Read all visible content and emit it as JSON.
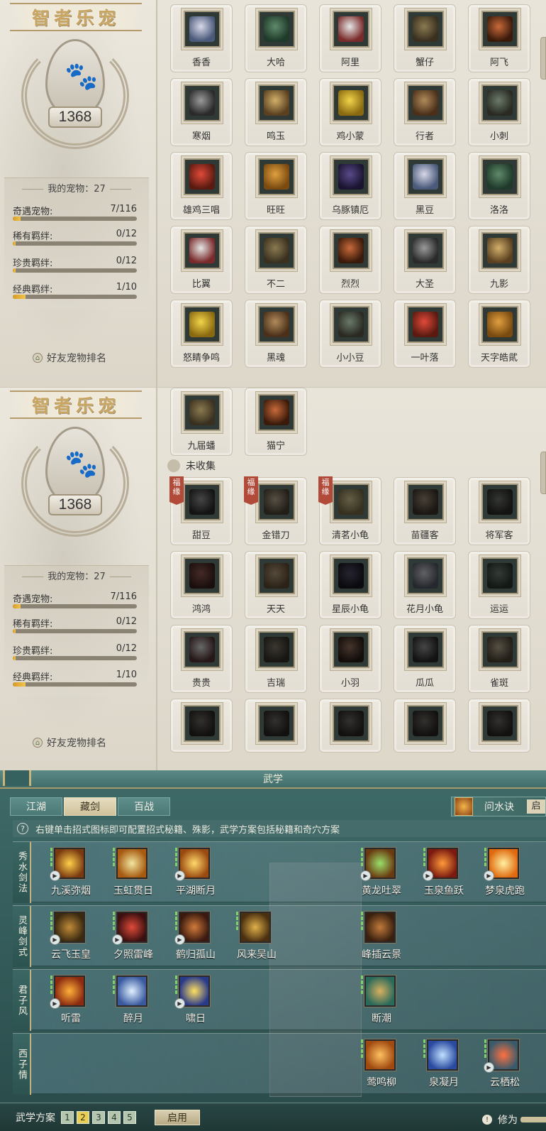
{
  "panel1": {
    "title": "智者乐宠",
    "score": "1368",
    "my_pets_label": "我的宠物：27",
    "stats": [
      {
        "name": "奇遇宠物:",
        "value": "7/116",
        "fraction": 0.06
      },
      {
        "name": "稀有羁绊:",
        "value": "0/12",
        "fraction": 0.0
      },
      {
        "name": "珍贵羁绊:",
        "value": "0/12",
        "fraction": 0.0
      },
      {
        "name": "经典羁绊:",
        "value": "1/10",
        "fraction": 0.1
      }
    ],
    "friend_rank": "好友宠物排名",
    "pets": [
      {
        "name": "香香"
      },
      {
        "name": "大哈"
      },
      {
        "name": "阿里"
      },
      {
        "name": "蟹仔"
      },
      {
        "name": "阿飞"
      },
      {
        "name": "寒烟"
      },
      {
        "name": "鸣玉"
      },
      {
        "name": "鸡小蒙"
      },
      {
        "name": "行者"
      },
      {
        "name": "小刺"
      },
      {
        "name": "雄鸡三唱"
      },
      {
        "name": "旺旺"
      },
      {
        "name": "乌豚镇厄"
      },
      {
        "name": "黑豆"
      },
      {
        "name": "洛洛"
      },
      {
        "name": "比翼"
      },
      {
        "name": "不二"
      },
      {
        "name": "烈烈"
      },
      {
        "name": "大圣"
      },
      {
        "name": "九影"
      },
      {
        "name": "怒睛争鸣"
      },
      {
        "name": "黑魂"
      },
      {
        "name": "小小豆"
      },
      {
        "name": "一叶落"
      },
      {
        "name": "天字皓貮"
      }
    ]
  },
  "panel2": {
    "title": "智者乐宠",
    "score": "1368",
    "my_pets_label": "我的宠物：27",
    "stats": [
      {
        "name": "奇遇宠物:",
        "value": "7/116",
        "fraction": 0.06
      },
      {
        "name": "稀有羁绊:",
        "value": "0/12",
        "fraction": 0.0
      },
      {
        "name": "珍贵羁绊:",
        "value": "0/12",
        "fraction": 0.0
      },
      {
        "name": "经典羁绊:",
        "value": "1/10",
        "fraction": 0.1
      }
    ],
    "friend_rank": "好友宠物排名",
    "collected": [
      {
        "name": "九届蟠"
      },
      {
        "name": "猫宁"
      }
    ],
    "uncollected_header": "未收集",
    "fate_tag": "福缘",
    "uncollected": [
      {
        "name": "甜豆",
        "fate": true
      },
      {
        "name": "金错刀",
        "fate": true
      },
      {
        "name": "清茗小龟",
        "fate": true
      },
      {
        "name": "苗疆客",
        "fate": false
      },
      {
        "name": "将军客",
        "fate": false
      },
      {
        "name": "鸿鸿",
        "fate": false
      },
      {
        "name": "天天",
        "fate": false
      },
      {
        "name": "星辰小龟",
        "fate": false
      },
      {
        "name": "花月小龟",
        "fate": false
      },
      {
        "name": "运运",
        "fate": false
      },
      {
        "name": "贵贵",
        "fate": false
      },
      {
        "name": "吉瑞",
        "fate": false
      },
      {
        "name": "小羽",
        "fate": false
      },
      {
        "name": "瓜瓜",
        "fate": false
      },
      {
        "name": "雀斑",
        "fate": false
      }
    ]
  },
  "martial": {
    "title": "武学",
    "tabs": [
      "江湖",
      "藏剑",
      "百战"
    ],
    "active_tab": 1,
    "mind_label": "问水诀",
    "mind_cut": "启",
    "hint": "右键单击招式图标即可配置招式秘籍、殊影，武学方案包括秘籍和奇穴方案",
    "rows": [
      {
        "label": "秀水剑法",
        "skills": [
          "九溪弥烟",
          "玉虹贯日",
          "平湖断月",
          "黄龙吐翠",
          "玉泉鱼跃",
          "梦泉虎跑"
        ]
      },
      {
        "label": "灵峰剑式",
        "skills": [
          "云飞玉皇",
          "夕照雷峰",
          "鹤归孤山",
          "风来吴山",
          "峰插云景"
        ]
      },
      {
        "label": "君子风",
        "skills": [
          "听雷",
          "醉月",
          "啸日",
          "断潮"
        ]
      },
      {
        "label": "西子情",
        "skills": [
          "莺鸣柳",
          "泉凝月",
          "云栖松"
        ]
      }
    ],
    "plan_label": "武学方案",
    "plans": [
      "1",
      "2",
      "3",
      "4",
      "5"
    ],
    "active_plan": 1,
    "enable_label": "启用",
    "cultivate_label": "修为"
  }
}
